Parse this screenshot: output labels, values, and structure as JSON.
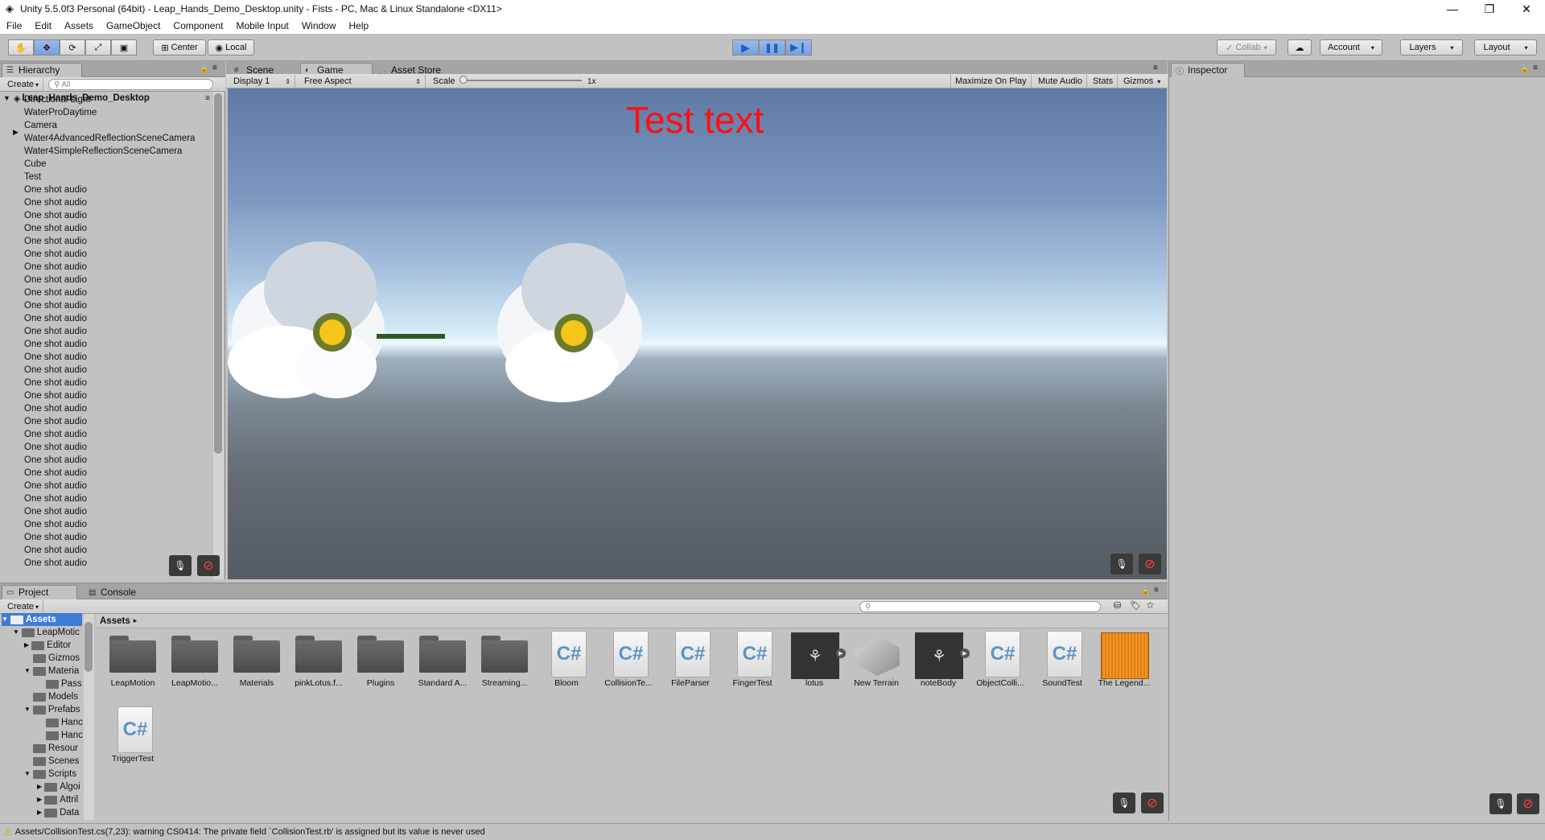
{
  "window": {
    "title": "Unity 5.5.0f3 Personal (64bit) - Leap_Hands_Demo_Desktop.unity - Fists - PC, Mac & Linux Standalone <DX11>",
    "minimize": "—",
    "restore": "❐",
    "close": "✕"
  },
  "menu": [
    "File",
    "Edit",
    "Assets",
    "GameObject",
    "Component",
    "Mobile Input",
    "Window",
    "Help"
  ],
  "toolbar": {
    "pivot": "Center",
    "space": "Local",
    "collab": "Collab",
    "account": "Account",
    "layers": "Layers",
    "layout": "Layout"
  },
  "hierarchy": {
    "tab": "Hierarchy",
    "create": "Create",
    "search_placeholder": "All",
    "scene": "Leap_Hands_Demo_Desktop",
    "items": [
      "Directional Light",
      "WaterProDaytime",
      "Camera",
      "Water4AdvancedReflectionSceneCamera",
      "Water4SimpleReflectionSceneCamera",
      "Cube",
      "Test",
      "One shot audio",
      "One shot audio",
      "One shot audio",
      "One shot audio",
      "One shot audio",
      "One shot audio",
      "One shot audio",
      "One shot audio",
      "One shot audio",
      "One shot audio",
      "One shot audio",
      "One shot audio",
      "One shot audio",
      "One shot audio",
      "One shot audio",
      "One shot audio",
      "One shot audio",
      "One shot audio",
      "One shot audio",
      "One shot audio",
      "One shot audio",
      "One shot audio",
      "One shot audio",
      "One shot audio",
      "One shot audio",
      "One shot audio",
      "One shot audio",
      "One shot audio",
      "One shot audio",
      "One shot audio"
    ]
  },
  "center_tabs": {
    "scene": "Scene",
    "game": "Game",
    "asset_store": "Asset Store"
  },
  "game": {
    "display": "Display 1",
    "aspect": "Free Aspect",
    "scale_label": "Scale",
    "scale_value": "1x",
    "maximize": "Maximize On Play",
    "mute": "Mute Audio",
    "stats": "Stats",
    "gizmos": "Gizmos",
    "overlay_text": "Test text"
  },
  "inspector": {
    "tab": "Inspector"
  },
  "project": {
    "tab": "Project",
    "console_tab": "Console",
    "create": "Create",
    "breadcrumb": "Assets",
    "tree": [
      "Assets",
      "LeapMotic",
      "Editor",
      "Gizmos",
      "Materia",
      "Pass",
      "Models",
      "Prefabs",
      "Hanc",
      "Hanc",
      "Resour",
      "Scenes",
      "Scripts",
      "Algoi",
      "Attril",
      "Data"
    ],
    "assets": [
      {
        "name": "LeapMotion",
        "type": "folder"
      },
      {
        "name": "LeapMotio...",
        "type": "folder"
      },
      {
        "name": "Materials",
        "type": "folder"
      },
      {
        "name": "pinkLotus.f...",
        "type": "folder"
      },
      {
        "name": "Plugins",
        "type": "folder"
      },
      {
        "name": "Standard A...",
        "type": "folder"
      },
      {
        "name": "Streaming...",
        "type": "folder"
      },
      {
        "name": "Bloom",
        "type": "script"
      },
      {
        "name": "CollisionTe...",
        "type": "script"
      },
      {
        "name": "FileParser",
        "type": "script"
      },
      {
        "name": "FingerTest",
        "type": "script"
      },
      {
        "name": "lotus",
        "type": "model"
      },
      {
        "name": "New Terrain",
        "type": "terrain"
      },
      {
        "name": "noteBody",
        "type": "model"
      },
      {
        "name": "ObjectColli...",
        "type": "script"
      },
      {
        "name": "SoundTest",
        "type": "script"
      },
      {
        "name": "The Legend...",
        "type": "audio"
      },
      {
        "name": "TriggerTest",
        "type": "script"
      }
    ]
  },
  "status": {
    "message": "Assets/CollisionTest.cs(7,23): warning CS0414: The private field `CollisionTest.rb' is assigned but its value is never used"
  },
  "colors": {
    "accent": "#3d7bd6",
    "game_text": "#ff1010"
  }
}
